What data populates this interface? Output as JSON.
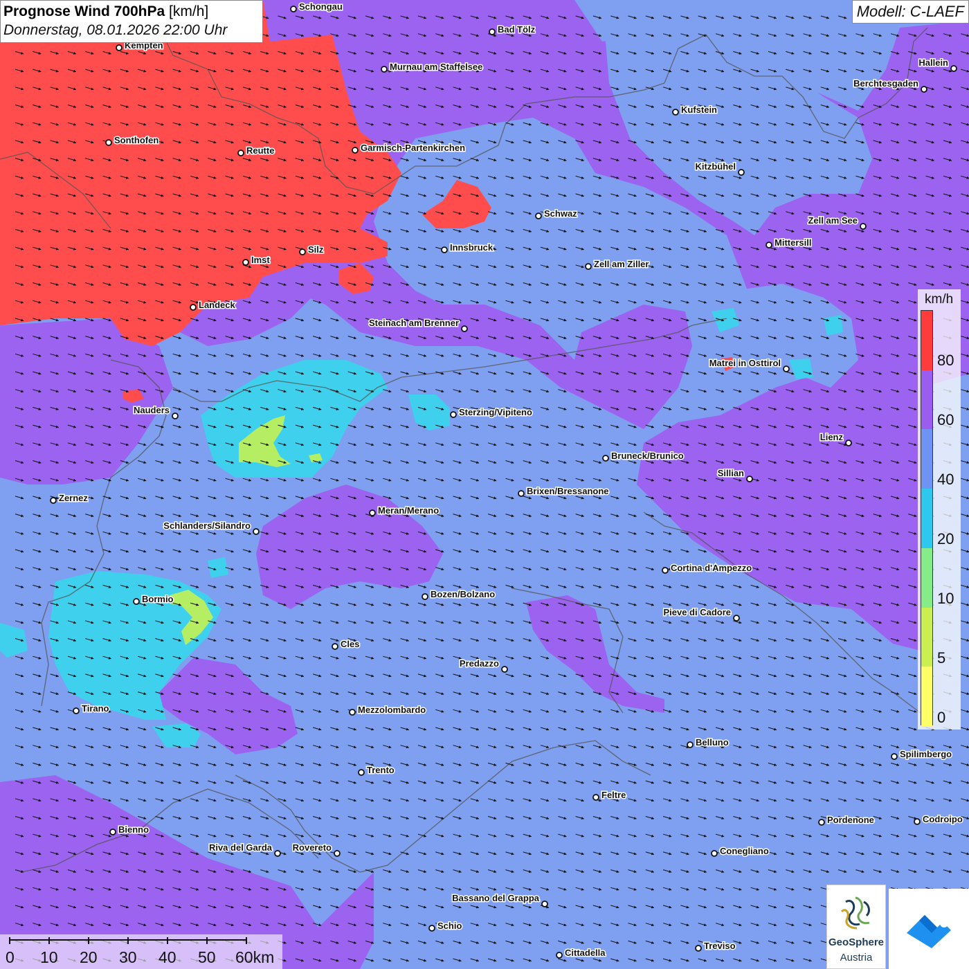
{
  "title": {
    "main_bold": "Prognose Wind 700hPa",
    "unit": "[km/h]",
    "datetime": "Donnerstag, 08.01.2026 22:00 Uhr"
  },
  "model_label": "Modell: C-LAEF",
  "legend": {
    "unit": "km/h",
    "labels": [
      "80",
      "60",
      "40",
      "20",
      "10",
      "5",
      "0"
    ],
    "colors": [
      "#ff3b3b",
      "#9b5cf0",
      "#6f93f2",
      "#2ec8ef",
      "#86ec8a",
      "#c9f050",
      "#ffff66"
    ]
  },
  "scale": {
    "labels": [
      "0",
      "10",
      "20",
      "30",
      "40",
      "50",
      "60km"
    ]
  },
  "logo": {
    "name": "GeoSphere",
    "sub": "Austria",
    "icon": "geosphere-logo-icon"
  },
  "app_icon": "weather-app-logo-icon",
  "cities": [
    {
      "name": "Schongau",
      "label_side": "right"
    },
    {
      "name": "Bad Tölz",
      "label_side": "right"
    },
    {
      "name": "Kempten",
      "label_side": "right"
    },
    {
      "name": "Murnau am Staffelsee",
      "label_side": "right"
    },
    {
      "name": "Hallein",
      "label_side": "left"
    },
    {
      "name": "Berchtesgaden",
      "label_side": "left"
    },
    {
      "name": "Kufstein",
      "label_side": "right"
    },
    {
      "name": "Sonthofen",
      "label_side": "right"
    },
    {
      "name": "Reutte",
      "label_side": "right"
    },
    {
      "name": "Garmisch-Partenkirchen",
      "label_side": "right"
    },
    {
      "name": "Kitzbühel",
      "label_side": "left"
    },
    {
      "name": "Schwaz",
      "label_side": "right"
    },
    {
      "name": "Zell am See",
      "label_side": "left"
    },
    {
      "name": "Innsbruck",
      "label_side": "right"
    },
    {
      "name": "Mittersill",
      "label_side": "right"
    },
    {
      "name": "Silz",
      "label_side": "right"
    },
    {
      "name": "Imst",
      "label_side": "right"
    },
    {
      "name": "Zell am Ziller",
      "label_side": "right"
    },
    {
      "name": "Landeck",
      "label_side": "right"
    },
    {
      "name": "Steinach am Brenner",
      "label_side": "left"
    },
    {
      "name": "Matrei in Osttirol",
      "label_side": "left"
    },
    {
      "name": "Nauders",
      "label_side": "left"
    },
    {
      "name": "Sterzing/Vipiteno",
      "label_side": "right"
    },
    {
      "name": "Lienz",
      "label_side": "left"
    },
    {
      "name": "Bruneck/Brunico",
      "label_side": "right"
    },
    {
      "name": "Sillian",
      "label_side": "left"
    },
    {
      "name": "Zernez",
      "label_side": "right"
    },
    {
      "name": "Brixen/Bressanone",
      "label_side": "right"
    },
    {
      "name": "Meran/Merano",
      "label_side": "right"
    },
    {
      "name": "Schlanders/Silandro",
      "label_side": "left"
    },
    {
      "name": "Cortina d'Ampezzo",
      "label_side": "right"
    },
    {
      "name": "Bozen/Bolzano",
      "label_side": "right"
    },
    {
      "name": "Bormio",
      "label_side": "right"
    },
    {
      "name": "Pieve di Cadore",
      "label_side": "left"
    },
    {
      "name": "Cles",
      "label_side": "right"
    },
    {
      "name": "Predazzo",
      "label_side": "left"
    },
    {
      "name": "Tirano",
      "label_side": "right"
    },
    {
      "name": "Mezzolombardo",
      "label_side": "right"
    },
    {
      "name": "Belluno",
      "label_side": "right"
    },
    {
      "name": "Spilimbergo",
      "label_side": "right"
    },
    {
      "name": "Trento",
      "label_side": "right"
    },
    {
      "name": "Feltre",
      "label_side": "right"
    },
    {
      "name": "Pordenone",
      "label_side": "right"
    },
    {
      "name": "Codroipo",
      "label_side": "right"
    },
    {
      "name": "Bienno",
      "label_side": "right"
    },
    {
      "name": "Riva del Garda",
      "label_side": "left"
    },
    {
      "name": "Rovereto",
      "label_side": "left"
    },
    {
      "name": "Conegliano",
      "label_side": "right"
    },
    {
      "name": "Bassano del Grappa",
      "label_side": "left"
    },
    {
      "name": "Schio",
      "label_side": "right"
    },
    {
      "name": "Treviso",
      "label_side": "right"
    },
    {
      "name": "Cittadella",
      "label_side": "right"
    }
  ]
}
